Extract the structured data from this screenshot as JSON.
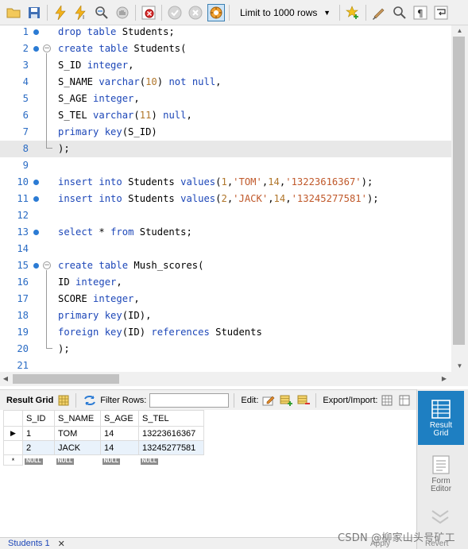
{
  "toolbar": {
    "limit_label": "Limit to 1000 rows"
  },
  "editor": {
    "lines": [
      {
        "n": "1",
        "parts": [
          [
            "kw",
            "drop table "
          ],
          [
            "op",
            "Students;"
          ]
        ],
        "marker": true
      },
      {
        "n": "2",
        "parts": [
          [
            "kw",
            "create table "
          ],
          [
            "op",
            "Students("
          ]
        ],
        "marker": true,
        "fold": "start"
      },
      {
        "n": "3",
        "parts": [
          [
            "op",
            "S_ID "
          ],
          [
            "kw",
            "integer"
          ],
          [
            "op",
            ","
          ]
        ]
      },
      {
        "n": "4",
        "parts": [
          [
            "op",
            "S_NAME "
          ],
          [
            "kw",
            "varchar"
          ],
          [
            "op",
            "("
          ],
          [
            "num",
            "10"
          ],
          [
            "op",
            ") "
          ],
          [
            "kw",
            "not null"
          ],
          [
            "op",
            ","
          ]
        ]
      },
      {
        "n": "5",
        "parts": [
          [
            "op",
            "S_AGE "
          ],
          [
            "kw",
            "integer"
          ],
          [
            "op",
            ","
          ]
        ]
      },
      {
        "n": "6",
        "parts": [
          [
            "op",
            "S_TEL "
          ],
          [
            "kw",
            "varchar"
          ],
          [
            "op",
            "("
          ],
          [
            "num",
            "11"
          ],
          [
            "op",
            ") "
          ],
          [
            "kw",
            "null"
          ],
          [
            "op",
            ","
          ]
        ]
      },
      {
        "n": "7",
        "parts": [
          [
            "kw",
            "primary key"
          ],
          [
            "op",
            "(S_ID)"
          ]
        ]
      },
      {
        "n": "8",
        "parts": [
          [
            "op",
            ");"
          ]
        ],
        "fold": "end",
        "current": true
      },
      {
        "n": "9",
        "parts": []
      },
      {
        "n": "10",
        "parts": [
          [
            "kw",
            "insert into "
          ],
          [
            "op",
            "Students "
          ],
          [
            "kw",
            "values"
          ],
          [
            "op",
            "("
          ],
          [
            "num",
            "1"
          ],
          [
            "op",
            ","
          ],
          [
            "str",
            "'TOM'"
          ],
          [
            "op",
            ","
          ],
          [
            "num",
            "14"
          ],
          [
            "op",
            ","
          ],
          [
            "str",
            "'13223616367'"
          ],
          [
            "op",
            ");"
          ]
        ],
        "marker": true
      },
      {
        "n": "11",
        "parts": [
          [
            "kw",
            "insert into "
          ],
          [
            "op",
            "Students "
          ],
          [
            "kw",
            "values"
          ],
          [
            "op",
            "("
          ],
          [
            "num",
            "2"
          ],
          [
            "op",
            ","
          ],
          [
            "str",
            "'JACK'"
          ],
          [
            "op",
            ","
          ],
          [
            "num",
            "14"
          ],
          [
            "op",
            ","
          ],
          [
            "str",
            "'13245277581'"
          ],
          [
            "op",
            ");"
          ]
        ],
        "marker": true
      },
      {
        "n": "12",
        "parts": []
      },
      {
        "n": "13",
        "parts": [
          [
            "kw",
            "select "
          ],
          [
            "op",
            "* "
          ],
          [
            "kw",
            "from "
          ],
          [
            "op",
            "Students;"
          ]
        ],
        "marker": true
      },
      {
        "n": "14",
        "parts": []
      },
      {
        "n": "15",
        "parts": [
          [
            "kw",
            "create table "
          ],
          [
            "op",
            "Mush_scores("
          ]
        ],
        "marker": true,
        "fold": "start"
      },
      {
        "n": "16",
        "parts": [
          [
            "op",
            "ID "
          ],
          [
            "kw",
            "integer"
          ],
          [
            "op",
            ","
          ]
        ]
      },
      {
        "n": "17",
        "parts": [
          [
            "op",
            "SCORE "
          ],
          [
            "kw",
            "integer"
          ],
          [
            "op",
            ","
          ]
        ]
      },
      {
        "n": "18",
        "parts": [
          [
            "kw",
            "primary key"
          ],
          [
            "op",
            "(ID),"
          ]
        ]
      },
      {
        "n": "19",
        "parts": [
          [
            "kw",
            "foreign key"
          ],
          [
            "op",
            "(ID) "
          ],
          [
            "kw",
            "references "
          ],
          [
            "op",
            "Students"
          ]
        ]
      },
      {
        "n": "20",
        "parts": [
          [
            "op",
            ");"
          ]
        ],
        "fold": "end"
      },
      {
        "n": "21",
        "parts": []
      }
    ]
  },
  "result_toolbar": {
    "result_grid_label": "Result Grid",
    "filter_rows_label": "Filter Rows:",
    "filter_rows_value": "",
    "edit_label": "Edit:",
    "export_import_label": "Export/Import:"
  },
  "grid": {
    "columns": [
      "S_ID",
      "S_NAME",
      "S_AGE",
      "S_TEL"
    ],
    "rows": [
      [
        "1",
        "TOM",
        "14",
        "13223616367"
      ],
      [
        "2",
        "JACK",
        "14",
        "13245277581"
      ]
    ],
    "null_label": "NULL",
    "new_row_marker": "*"
  },
  "side_panel": {
    "result_grid_label": "Result Grid",
    "form_editor_label": "Form Editor"
  },
  "bottom": {
    "tab_label": "Students 1",
    "close_label": "✕",
    "apply_label": "Apply",
    "revert_label": "Revert",
    "watermark": "CSDN @柳家山头号矿工"
  },
  "colors": {
    "keyword": "#1d47b8",
    "number": "#b0762b",
    "string": "#c0592b",
    "line_number": "#2b6cc4",
    "active_side_button": "#1e7fc2"
  }
}
